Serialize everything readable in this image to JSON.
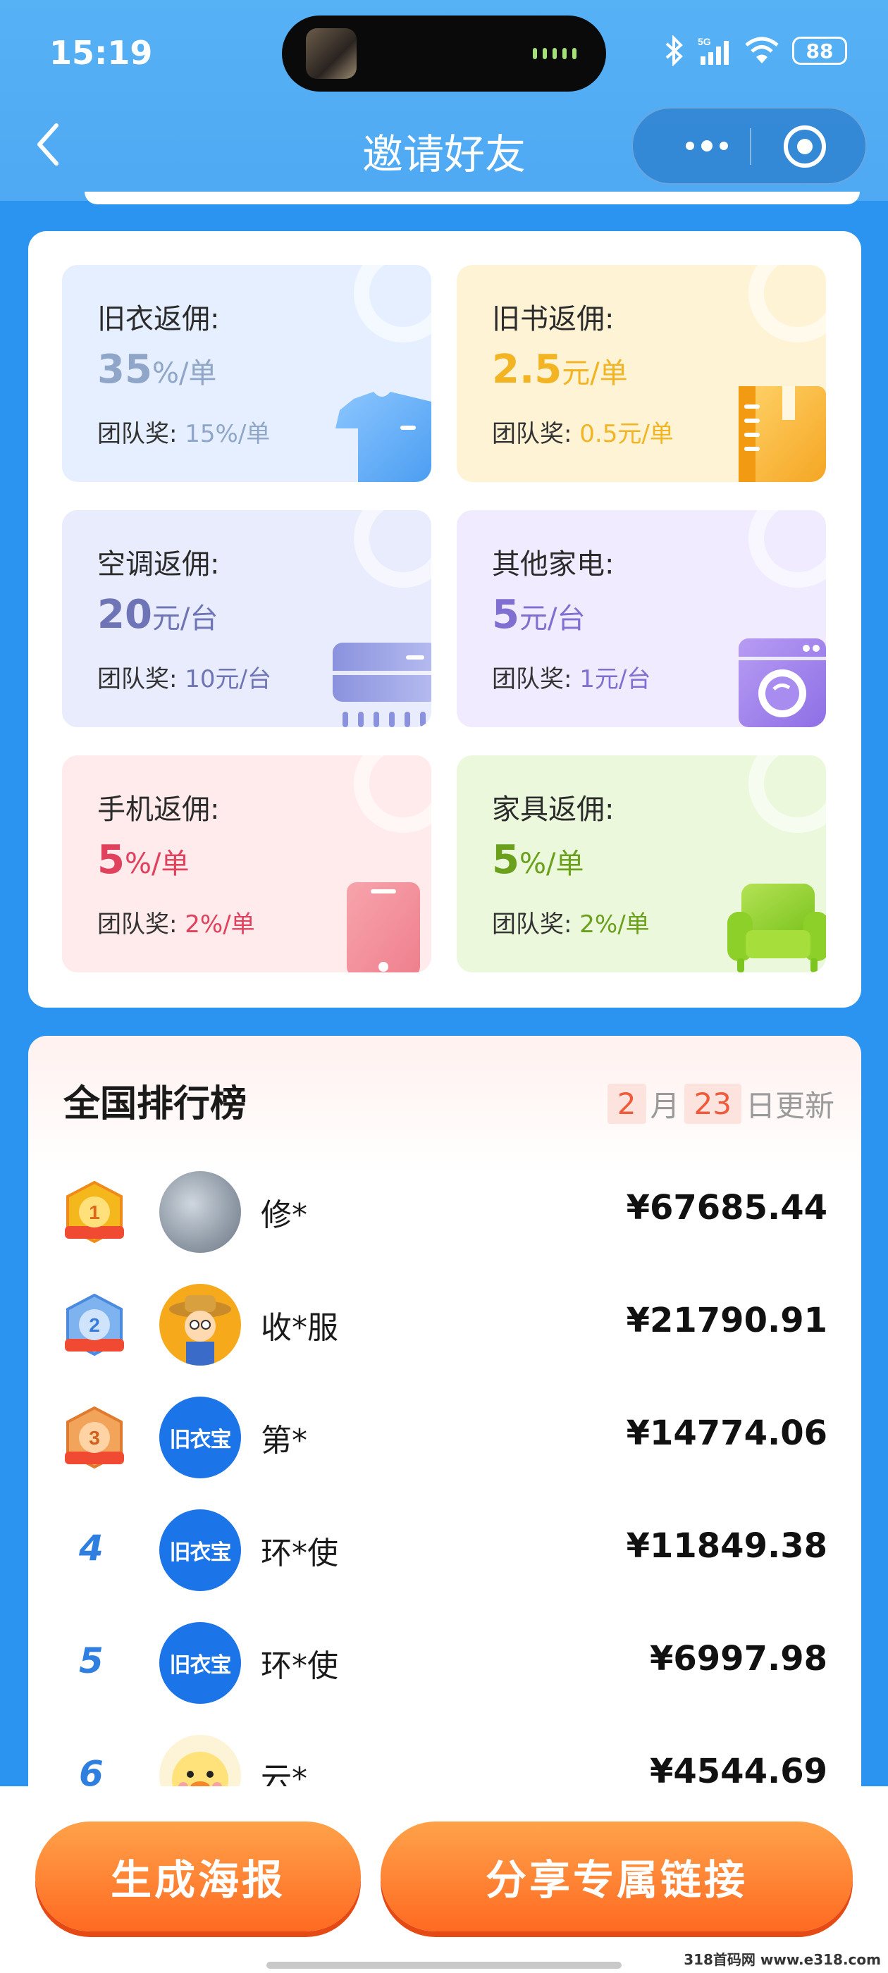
{
  "status_bar": {
    "time": "15:19",
    "battery": "88",
    "network": "5G"
  },
  "header": {
    "title": "邀请好友"
  },
  "commission": {
    "items": [
      {
        "title": "旧衣返佣:",
        "rate": "35",
        "unit": "%/单",
        "team_label": "团队奖:",
        "team_value": "15%/单",
        "color": "#8fa6c8",
        "icon": "tshirt-icon"
      },
      {
        "title": "旧书返佣:",
        "rate": "2.5",
        "unit": "元/单",
        "team_label": "团队奖:",
        "team_value": "0.5元/单",
        "color": "#f2b422",
        "icon": "book-icon"
      },
      {
        "title": "空调返佣:",
        "rate": "20",
        "unit": "元/台",
        "team_label": "团队奖:",
        "team_value": "10元/台",
        "color": "#6e74b6",
        "icon": "air-conditioner-icon"
      },
      {
        "title": "其他家电:",
        "rate": "5",
        "unit": "元/台",
        "team_label": "团队奖:",
        "team_value": "1元/台",
        "color": "#7f6fd0",
        "icon": "washing-machine-icon"
      },
      {
        "title": "手机返佣:",
        "rate": "5",
        "unit": "%/单",
        "team_label": "团队奖:",
        "team_value": "2%/单",
        "color": "#e0415c",
        "icon": "phone-icon"
      },
      {
        "title": "家具返佣:",
        "rate": "5",
        "unit": "%/单",
        "team_label": "团队奖:",
        "team_value": "2%/单",
        "color": "#6aa01c",
        "icon": "sofa-icon"
      }
    ]
  },
  "ranking": {
    "title": "全国排行榜",
    "date_month": "2",
    "date_month_label": "月",
    "date_day": "23",
    "date_day_label": "日更新",
    "rows": [
      {
        "rank": "1",
        "name": "修*",
        "amount": "¥67685.44",
        "avatar": "photo"
      },
      {
        "rank": "2",
        "name": "收*服",
        "amount": "¥21790.91",
        "avatar": "farmer"
      },
      {
        "rank": "3",
        "name": "第*",
        "amount": "¥14774.06",
        "avatar": "brand"
      },
      {
        "rank": "4",
        "name": "环*使",
        "amount": "¥11849.38",
        "avatar": "brand"
      },
      {
        "rank": "5",
        "name": "环*使",
        "amount": "¥6997.98",
        "avatar": "brand"
      },
      {
        "rank": "6",
        "name": "云*",
        "amount": "¥4544.69",
        "avatar": "duck"
      }
    ],
    "brand_avatar_text": "旧衣宝"
  },
  "actions": {
    "poster_label": "生成海报",
    "share_label": "分享专属链接"
  },
  "watermark": "318首码网 www.e318.com"
}
